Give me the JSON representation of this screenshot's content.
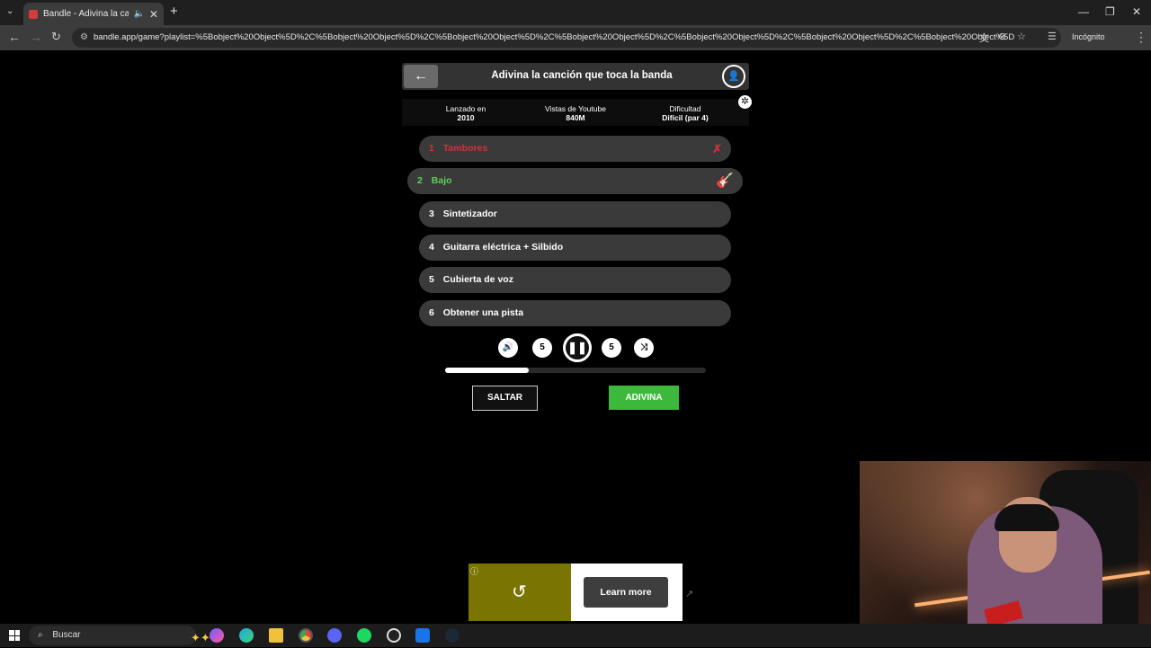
{
  "browser": {
    "tab_title": "Bandle - Adivina la canción",
    "url": "bandle.app/game?playlist=%5Bobject%20Object%5D%2C%5Bobject%20Object%5D%2C%5Bobject%20Object%5D%2C%5Bobject%20Object%5D%2C%5Bobject%20Object%5D%2C%5Bobject%20Object%5D%2C%5Bobject%20Object%5D",
    "profile_label": "Incógnito"
  },
  "game": {
    "title": "Adivina la canción que toca la banda",
    "stats": [
      {
        "label": "Lanzado en",
        "value": "2010"
      },
      {
        "label": "Vistas de Youtube",
        "value": "840M"
      },
      {
        "label": "Dificultad",
        "value": "Difícil (par 4)"
      }
    ],
    "tracks": [
      {
        "num": "1",
        "label": "Tambores",
        "state": "failed"
      },
      {
        "num": "2",
        "label": "Bajo",
        "state": "current"
      },
      {
        "num": "3",
        "label": "Sintetizador",
        "state": "locked"
      },
      {
        "num": "4",
        "label": "Guitarra eléctrica + Silbido",
        "state": "locked"
      },
      {
        "num": "5",
        "label": "Cubierta de voz",
        "state": "locked"
      },
      {
        "num": "6",
        "label": "Obtener una pista",
        "state": "locked"
      }
    ],
    "rewind_label": "5",
    "forward_label": "5",
    "progress_fraction": 0.32,
    "skip_label": "SALTAR",
    "guess_label": "ADIVINA"
  },
  "ad": {
    "learn_more": "Learn more"
  },
  "taskbar": {
    "search_placeholder": "Buscar"
  },
  "colors": {
    "failed": "#d4303c",
    "current": "#5bd156",
    "guess_button": "#3cb93a"
  }
}
